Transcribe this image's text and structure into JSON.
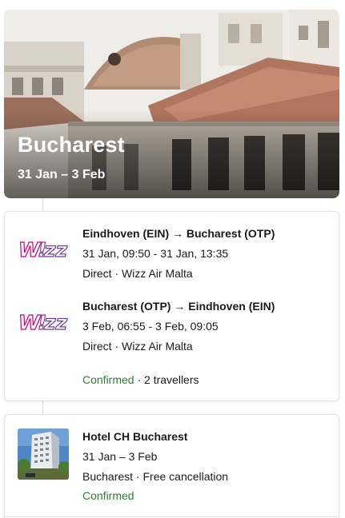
{
  "destination": {
    "city": "Bucharest",
    "dates": "31 Jan – 3 Feb"
  },
  "flights": {
    "segments": [
      {
        "airline_logo": "Wizz",
        "route": "Eindhoven (EIN) → Bucharest (OTP)",
        "times": "31 Jan, 09:50 - 31 Jan, 13:35",
        "details": "Direct · Wizz Air Malta"
      },
      {
        "airline_logo": "Wizz",
        "route": "Bucharest (OTP) → Eindhoven (EIN)",
        "times": "3 Feb, 06:55 - 3 Feb, 09:05",
        "details": "Direct · Wizz Air Malta"
      }
    ],
    "status": "Confirmed",
    "travellers": " · 2 travellers"
  },
  "hotel": {
    "name": "Hotel CH Bucharest",
    "dates": "31 Jan – 3 Feb",
    "location": "Bucharest · Free cancellation",
    "status": "Confirmed"
  },
  "colors": {
    "confirmed": "#2e7d32",
    "wizz_purple": "#c6007e",
    "wizz_violet": "#502379"
  }
}
